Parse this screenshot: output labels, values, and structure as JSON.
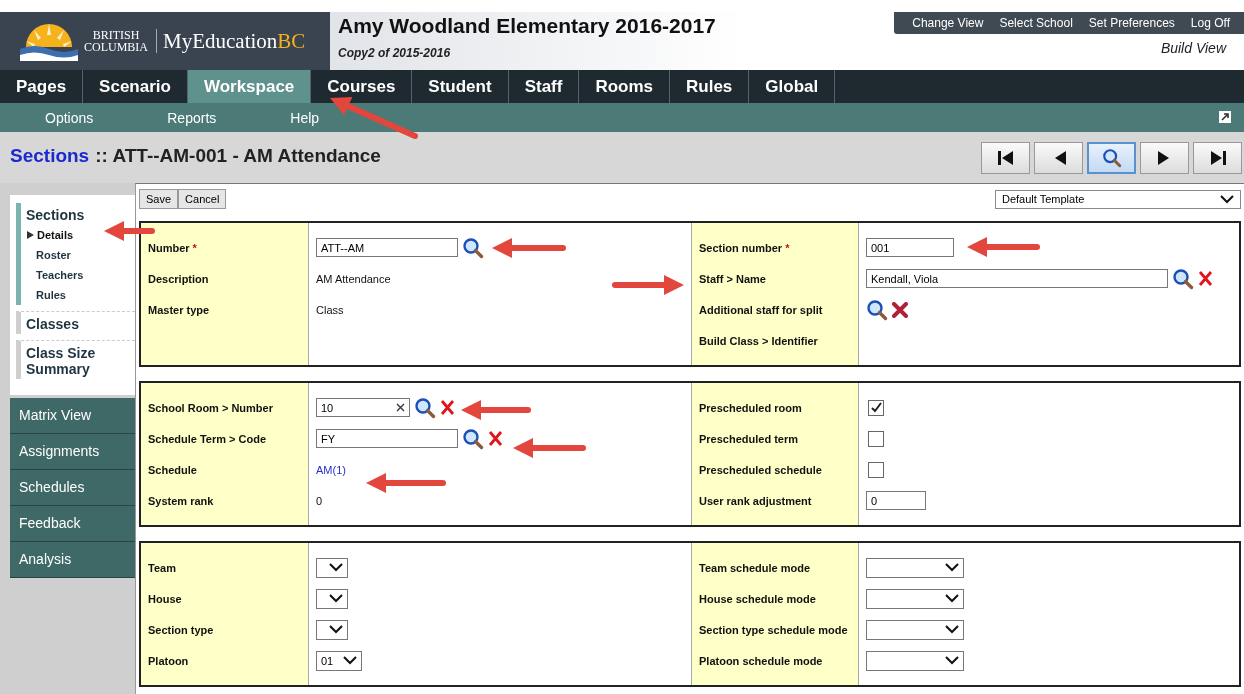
{
  "header": {
    "logo": {
      "line1": "BRITISH",
      "line2": "COLUMBIA",
      "brand": "MyEducation",
      "brand_suffix": "BC"
    },
    "title": "Amy Woodland Elementary 2016-2017",
    "subtitle": "Copy2 of 2015-2016",
    "top_links": [
      "Change View",
      "Select School",
      "Set Preferences",
      "Log Off"
    ],
    "view_label": "Build View"
  },
  "tabs": [
    {
      "label": "Pages",
      "selected": false
    },
    {
      "label": "Scenario",
      "selected": false
    },
    {
      "label": "Workspace",
      "selected": true
    },
    {
      "label": "Courses",
      "selected": false
    },
    {
      "label": "Student",
      "selected": false
    },
    {
      "label": "Staff",
      "selected": false
    },
    {
      "label": "Rooms",
      "selected": false
    },
    {
      "label": "Rules",
      "selected": false
    },
    {
      "label": "Global",
      "selected": false
    }
  ],
  "subnav": [
    "Options",
    "Reports",
    "Help"
  ],
  "page_title": {
    "link": "Sections",
    "rest": ":: ATT--AM-001 - AM Attendance"
  },
  "side_menu": {
    "group": "Sections",
    "items": [
      {
        "label": "Details",
        "selected": true
      },
      {
        "label": "Roster",
        "selected": false
      },
      {
        "label": "Teachers",
        "selected": false
      },
      {
        "label": "Rules",
        "selected": false
      }
    ],
    "other_groups": [
      "Classes",
      "Class Size Summary"
    ],
    "tabs": [
      "Matrix View",
      "Assignments",
      "Schedules",
      "Feedback",
      "Analysis"
    ]
  },
  "toolbar": {
    "buttons": [
      "Save",
      "Cancel"
    ],
    "template": "Default Template"
  },
  "sections": [
    {
      "left": [
        {
          "label": "Number",
          "required_mark": "*",
          "kind": "input",
          "value": "ATT--AM",
          "search": true
        },
        {
          "label": "Description",
          "kind": "static",
          "value": "AM Attendance"
        },
        {
          "label": "Master type",
          "kind": "static",
          "value": "Class"
        }
      ],
      "right": [
        {
          "label": "Section number",
          "required_mark": "*",
          "kind": "input",
          "value": "001"
        },
        {
          "label": "Staff > Name",
          "kind": "input",
          "value": "Kendall, Viola",
          "search": true,
          "clear": true
        },
        {
          "label": "Additional staff for split",
          "kind": "actions",
          "search": true,
          "remove": true
        },
        {
          "label": "Build Class > Identifier",
          "kind": "static"
        }
      ]
    },
    {
      "left": [
        {
          "label": "School Room > Number",
          "kind": "input",
          "value": "10",
          "clearable": true,
          "search": true,
          "clear": true
        },
        {
          "label": "Schedule Term > Code",
          "kind": "input",
          "value": "FY",
          "search": true,
          "clear": true
        },
        {
          "label": "Schedule",
          "kind": "link",
          "value": "AM(1)"
        },
        {
          "label": "System rank",
          "kind": "static",
          "value": "0"
        }
      ],
      "right": [
        {
          "label": "Prescheduled room",
          "kind": "checkbox",
          "checked": true
        },
        {
          "label": "Prescheduled term",
          "kind": "checkbox",
          "checked": false
        },
        {
          "label": "Prescheduled schedule",
          "kind": "checkbox",
          "checked": false
        },
        {
          "label": "User rank adjustment",
          "kind": "input",
          "value": "0"
        }
      ]
    },
    {
      "left": [
        {
          "label": "Team",
          "kind": "select"
        },
        {
          "label": "House",
          "kind": "select"
        },
        {
          "label": "Section type",
          "kind": "select"
        },
        {
          "label": "Platoon",
          "kind": "select",
          "value": "01"
        }
      ],
      "right": [
        {
          "label": "Team schedule mode",
          "kind": "select"
        },
        {
          "label": "House schedule mode",
          "kind": "select"
        },
        {
          "label": "Section type schedule mode",
          "kind": "select"
        },
        {
          "label": "Platoon schedule mode",
          "kind": "select"
        }
      ]
    }
  ]
}
